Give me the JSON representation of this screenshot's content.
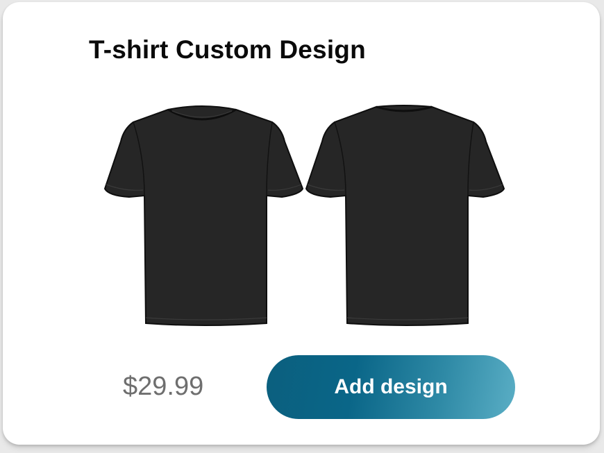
{
  "card": {
    "title": "T-shirt Custom Design"
  },
  "product": {
    "images": [
      {
        "view": "front",
        "icon": "tshirt-front-icon",
        "color": "#262626"
      },
      {
        "view": "back",
        "icon": "tshirt-back-icon",
        "color": "#262626"
      }
    ],
    "price": "$29.99"
  },
  "actions": {
    "add_design_label": "Add design"
  },
  "colors": {
    "button_gradient_start": "#0b5f7e",
    "button_gradient_end": "#5aaec5",
    "price_text": "#6e6e6e",
    "shirt": "#262626"
  }
}
